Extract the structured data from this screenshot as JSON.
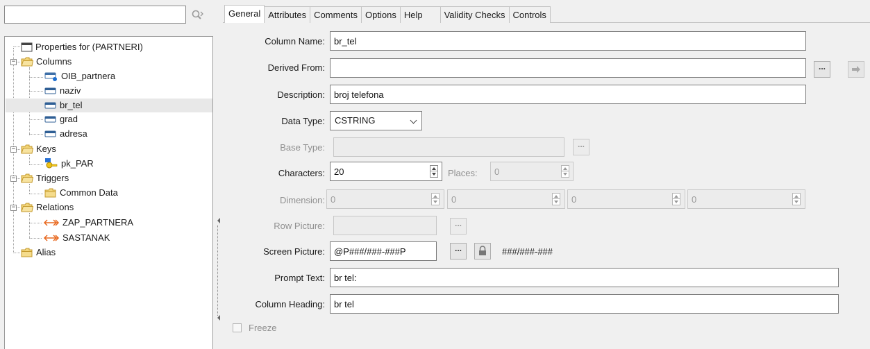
{
  "search": {
    "value": "",
    "placeholder": ""
  },
  "tree": {
    "properties": "Properties for (PARTNERI)",
    "columns": "Columns",
    "col_oib": "OIB_partnera",
    "col_naziv": "naziv",
    "col_br_tel": "br_tel",
    "col_grad": "grad",
    "col_adresa": "adresa",
    "keys": "Keys",
    "key_pk": "pk_PAR",
    "triggers": "Triggers",
    "common_data": "Common Data",
    "relations": "Relations",
    "rel_zap": "ZAP_PARTNERA",
    "rel_sast": "SASTANAK",
    "alias": "Alias"
  },
  "tabs": [
    "General",
    "Attributes",
    "Comments",
    "Options",
    "Help",
    "Validity Checks",
    "Controls"
  ],
  "form": {
    "column_name_label": "Column Name:",
    "column_name": "br_tel",
    "derived_from_label": "Derived From:",
    "derived_from": "",
    "description_label": "Description:",
    "description": "broj telefona",
    "data_type_label": "Data Type:",
    "data_type": "CSTRING",
    "base_type_label": "Base Type:",
    "base_type": "",
    "characters_label": "Characters:",
    "characters": "20",
    "places_label": "Places:",
    "places": "0",
    "dimension_label": "Dimension:",
    "dim1": "0",
    "dim2": "0",
    "dim3": "0",
    "dim4": "0",
    "row_picture_label": "Row Picture:",
    "row_picture": "",
    "screen_picture_label": "Screen Picture:",
    "screen_picture": "@P###/###-###P",
    "screen_picture_preview": "###/###-###",
    "prompt_text_label": "Prompt Text:",
    "prompt_text": "br tel:",
    "column_heading_label": "Column Heading:",
    "column_heading": "br tel",
    "freeze_label": "Freeze",
    "ellipsis": "..."
  },
  "colors": {
    "folder": "#e9c15a",
    "column_icon": "#3d6fa8",
    "relation": "#e8681e",
    "selected_row": "#e5e5e5"
  },
  "icons": {
    "search": "search-icon",
    "folder": "folder-icon",
    "column": "column-icon",
    "key": "key-icon",
    "relation": "relation-arrow-icon",
    "lock": "lock-icon",
    "arrow": "right-arrow-icon"
  }
}
